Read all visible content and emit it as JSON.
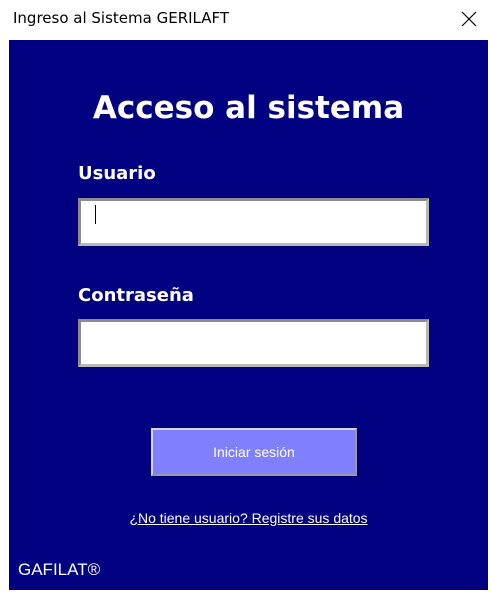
{
  "window": {
    "title": "Ingreso al Sistema GERILAFT",
    "close_icon": "close-icon"
  },
  "form": {
    "heading": "Acceso al sistema",
    "username_label": "Usuario",
    "username_value": "",
    "password_label": "Contraseña",
    "password_value": "",
    "login_button": "Iniciar sesión",
    "register_link": "¿No tiene usuario? Registre sus datos"
  },
  "footer": {
    "brand": "GAFILAT®"
  },
  "colors": {
    "background": "#000080",
    "button": "#8080ff",
    "text": "#ffffff"
  }
}
